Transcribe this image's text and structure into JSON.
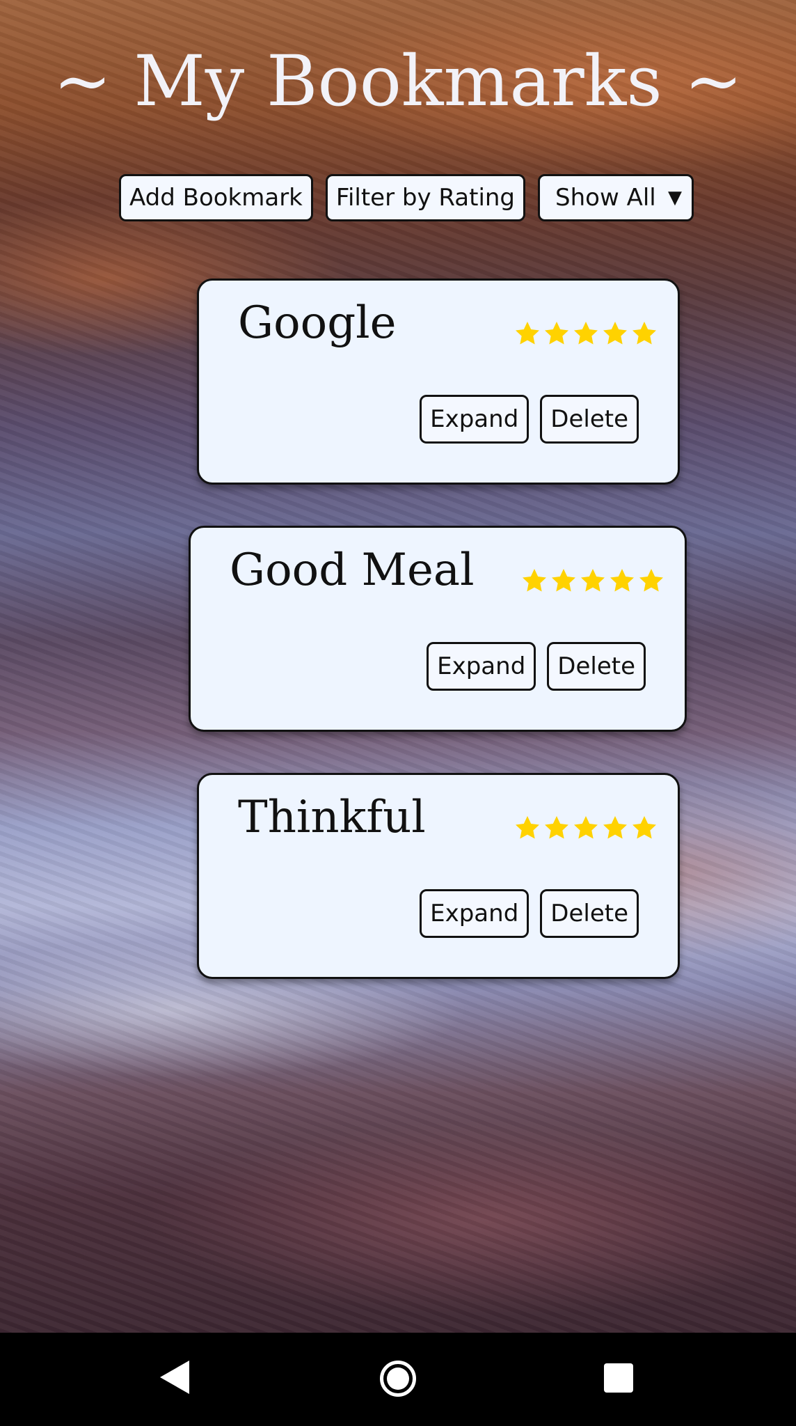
{
  "header": {
    "title": "~ My Bookmarks ~"
  },
  "toolbar": {
    "add_label": "Add Bookmark",
    "filter_label": "Filter by Rating",
    "select_value": "Show All"
  },
  "bookmarks": [
    {
      "title": "Google",
      "rating": 5,
      "expand_label": "Expand",
      "delete_label": "Delete"
    },
    {
      "title": "Good Meal",
      "rating": 5,
      "expand_label": "Expand",
      "delete_label": "Delete"
    },
    {
      "title": "Thinkful",
      "rating": 5,
      "expand_label": "Expand",
      "delete_label": "Delete"
    }
  ],
  "colors": {
    "star": "#ffd200",
    "card_bg": "#eef5ff"
  },
  "icons": {
    "rating": "star-icon",
    "nav_back": "back-icon",
    "nav_home": "home-icon",
    "nav_recent": "recent-apps-icon"
  }
}
